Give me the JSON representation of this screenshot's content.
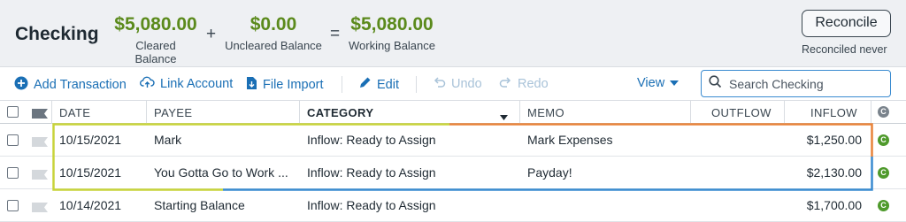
{
  "header": {
    "title": "Checking",
    "cleared": {
      "amount": "$5,080.00",
      "label": "Cleared Balance"
    },
    "plus": "+",
    "uncleared": {
      "amount": "$0.00",
      "label": "Uncleared Balance"
    },
    "equals": "=",
    "working": {
      "amount": "$5,080.00",
      "label": "Working Balance"
    },
    "reconcile_label": "Reconcile",
    "reconciled_note": "Reconciled never"
  },
  "toolbar": {
    "add_transaction": "Add Transaction",
    "link_account": "Link Account",
    "file_import": "File Import",
    "edit": "Edit",
    "undo": "Undo",
    "redo": "Redo",
    "view": "View",
    "search_placeholder": "Search Checking"
  },
  "columns": {
    "date": "DATE",
    "payee": "PAYEE",
    "category": "CATEGORY",
    "memo": "MEMO",
    "outflow": "OUTFLOW",
    "inflow": "INFLOW",
    "cleared": "C"
  },
  "rows": [
    {
      "date": "10/15/2021",
      "payee": "Mark",
      "category": "Inflow: Ready to Assign",
      "memo": "Mark Expenses",
      "outflow": "",
      "inflow": "$1,250.00",
      "cleared": "C"
    },
    {
      "date": "10/15/2021",
      "payee": "You Gotta Go to Work ...",
      "category": "Inflow: Ready to Assign",
      "memo": "Payday!",
      "outflow": "",
      "inflow": "$2,130.00",
      "cleared": "C"
    },
    {
      "date": "10/14/2021",
      "payee": "Starting Balance",
      "category": "Inflow: Ready to Assign",
      "memo": "",
      "outflow": "",
      "inflow": "$1,700.00",
      "cleared": "C"
    }
  ],
  "colors": {
    "accent": "#1a6fb5",
    "positive": "#5b8a1c",
    "highlight_yellow": "#c8d43a",
    "highlight_orange": "#e8833a",
    "highlight_blue": "#3a8bd0"
  }
}
